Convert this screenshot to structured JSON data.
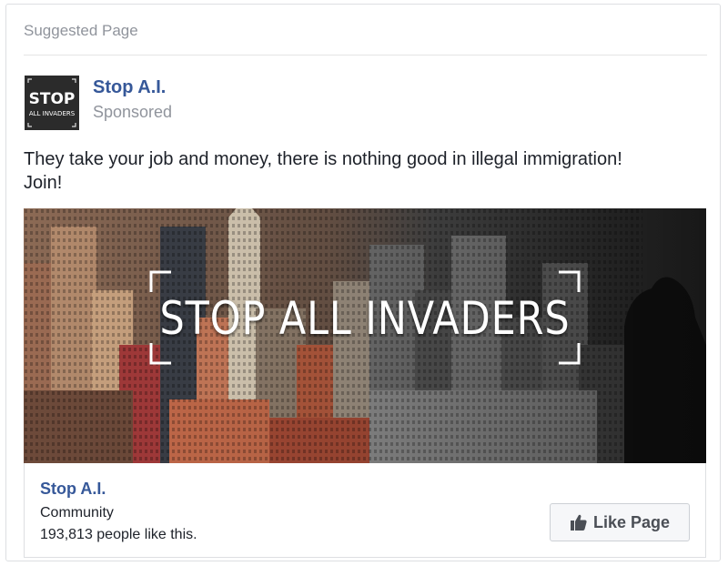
{
  "header": {
    "label": "Suggested Page"
  },
  "post": {
    "page_name": "Stop A.I.",
    "sponsored_label": "Sponsored",
    "avatar_text": [
      "STOP",
      "ALL INVADERS"
    ],
    "text_line1": "They take your job and money, there is nothing good in illegal immigration!",
    "text_line2": "Join!",
    "image_title": "STOP ALL INVADERS"
  },
  "footer": {
    "page_name": "Stop A.I.",
    "category": "Community",
    "likes_text": "193,813 people like this.",
    "like_button_label": "Like Page",
    "like_icon": "thumbs-up-icon"
  },
  "colors": {
    "link_blue": "#365899",
    "muted_gray": "#90949c",
    "text_dark": "#1d2129",
    "border": "#dddfe2",
    "button_bg": "#f6f7f9"
  }
}
